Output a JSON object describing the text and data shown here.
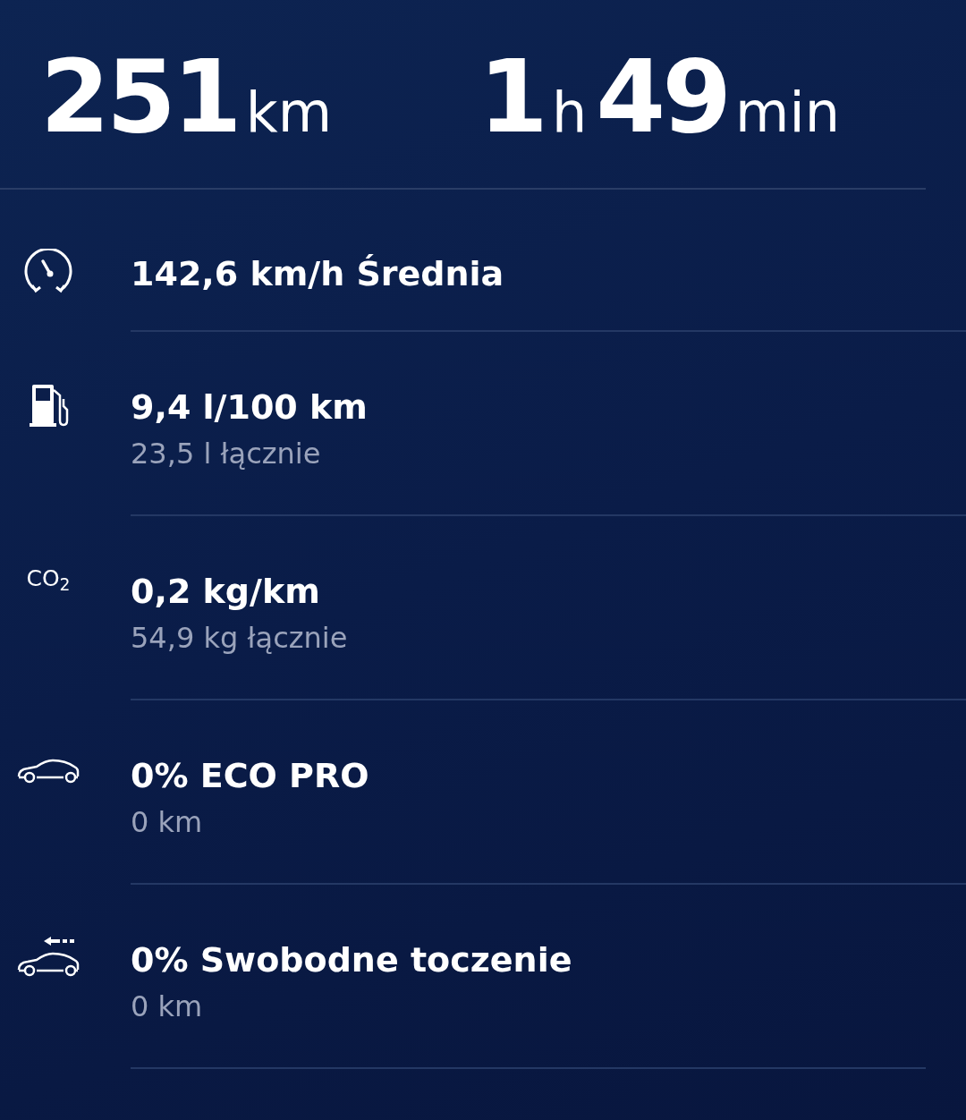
{
  "summary": [
    {
      "value": "251",
      "unit": "km"
    },
    {
      "value": "1",
      "unit": "h"
    },
    {
      "value": "49",
      "unit": "min"
    }
  ],
  "stats": [
    {
      "kind": "speed",
      "title": "142,6 km/h Średnia"
    },
    {
      "kind": "fuel",
      "title": "9,4 l/100 km",
      "subtitle": "23,5 l łącznie"
    },
    {
      "kind": "co2",
      "icon_text": "CO$_{2}$",
      "title": "0,2 kg/km",
      "subtitle": "54,9 kg łącznie"
    },
    {
      "kind": "eco",
      "title": "0% ECO PRO",
      "subtitle": "0 km"
    },
    {
      "kind": "coasting",
      "title": "0% Swobodne toczenie",
      "subtitle": "0 km"
    }
  ]
}
